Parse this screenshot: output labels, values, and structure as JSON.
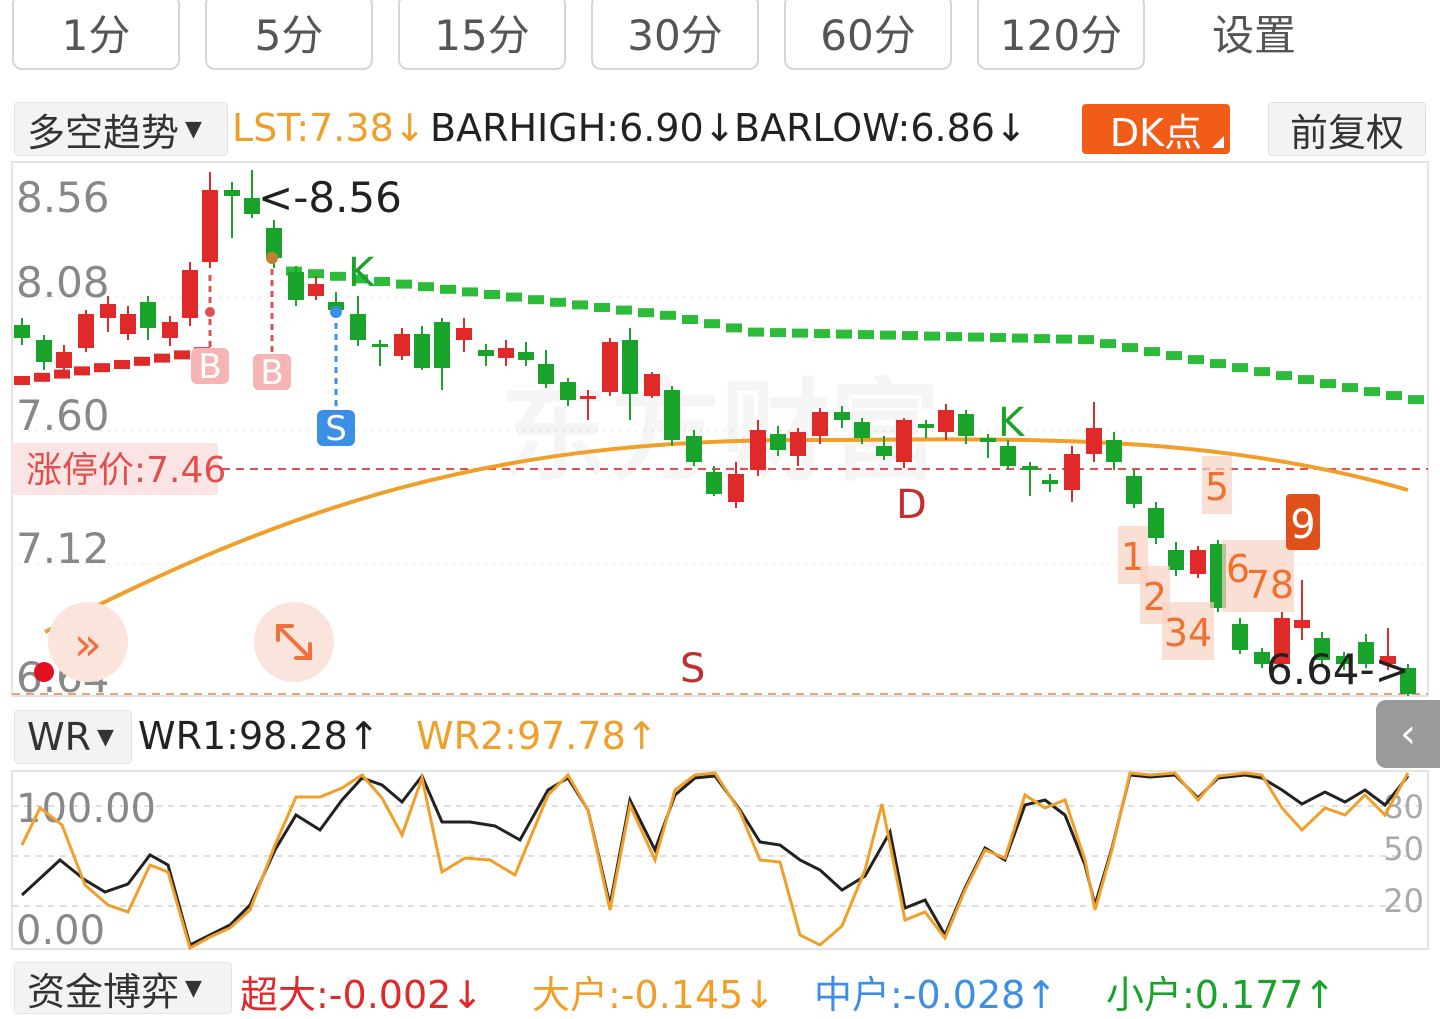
{
  "periods": [
    {
      "label": "1分"
    },
    {
      "label": "5分"
    },
    {
      "label": "15分"
    },
    {
      "label": "30分"
    },
    {
      "label": "60分"
    },
    {
      "label": "120分"
    }
  ],
  "settings_label": "设置",
  "main_indicator": {
    "selector": "多空趋势",
    "lst": "LST:7.38↓",
    "barhigh": "BARHIGH:6.90↓",
    "barlow": "BARLOW:6.86↓",
    "dk_label": "DK点",
    "adjust_label": "前复权"
  },
  "price_axis": [
    "8.56",
    "8.08",
    "7.60",
    "7.12",
    "6.64"
  ],
  "limit_price_label": "涨停价:7.46",
  "watermark": "东方财富",
  "annotations": {
    "high_label": "<-8.56",
    "low_label": "6.64->",
    "K": "K",
    "D": "D",
    "S": "S",
    "B": "B",
    "S_badge": "S",
    "nine": "9",
    "seq": [
      "1",
      "2",
      "34",
      "5",
      "6",
      "78"
    ]
  },
  "wr_indicator": {
    "selector": "WR",
    "wr1": "WR1:98.28↑",
    "wr2": "WR2:97.78↑",
    "axis_left": [
      "100.00",
      "0.00"
    ],
    "axis_right": [
      "80",
      "50",
      "20"
    ]
  },
  "fund_indicator": {
    "selector": "资金博弈",
    "super": "超大:-0.002↓",
    "large": "大户:-0.145↓",
    "medium": "中户:-0.028↑",
    "small": "小户:0.177↑"
  },
  "colors": {
    "up": "#e02a2a",
    "down": "#1aa32b",
    "orange": "#f0a02a",
    "dk": "#f25c19",
    "blue": "#3d8fe6",
    "limit": "#e05050"
  }
}
